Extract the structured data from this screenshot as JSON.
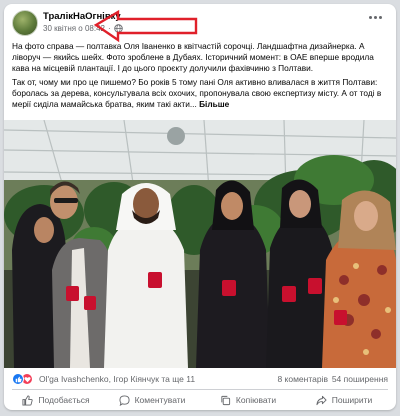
{
  "post": {
    "page_name": "ТралікНаОгнівку",
    "date": "30 квітня о 08:42",
    "privacy_icon": "globe-icon",
    "paragraph1": "На фото справа — полтавка Оля Іваненко в квітчастій сорочці. Ландшафтна дизайнерка. А ліворуч — якийсь шейх. Фото зроблене в Дубаях. Історичний момент: в ОАЕ вперше вродила кава на місцевій плантації. І до цього проєкту долучили фахівчиню з Полтави.",
    "paragraph2": "Так от, чому ми про це пишемо? Бо років 5 тому пані Оля активно вливалася в життя Полтави: боролась за дерева, консультувала всіх охочих, пропонувала свою експертизу місту. А от тоді в мерії сиділа мамайська братва, яким такі акти...",
    "see_more": "Більше"
  },
  "colors": {
    "annotation_arrow": "#e0202a",
    "like_blue": "#1877f2",
    "love_red": "#f33e58",
    "cup_red": "#c8102e"
  },
  "reactions": {
    "reactors_text": "Ol'ga Ivashchenko, Ігор Кіянчук та ще 11",
    "comments": "8 коментарів",
    "shares": "54 поширення"
  },
  "actions": {
    "like": "Подобається",
    "comment": "Коментувати",
    "copy": "Копіювати",
    "share": "Поширити"
  }
}
